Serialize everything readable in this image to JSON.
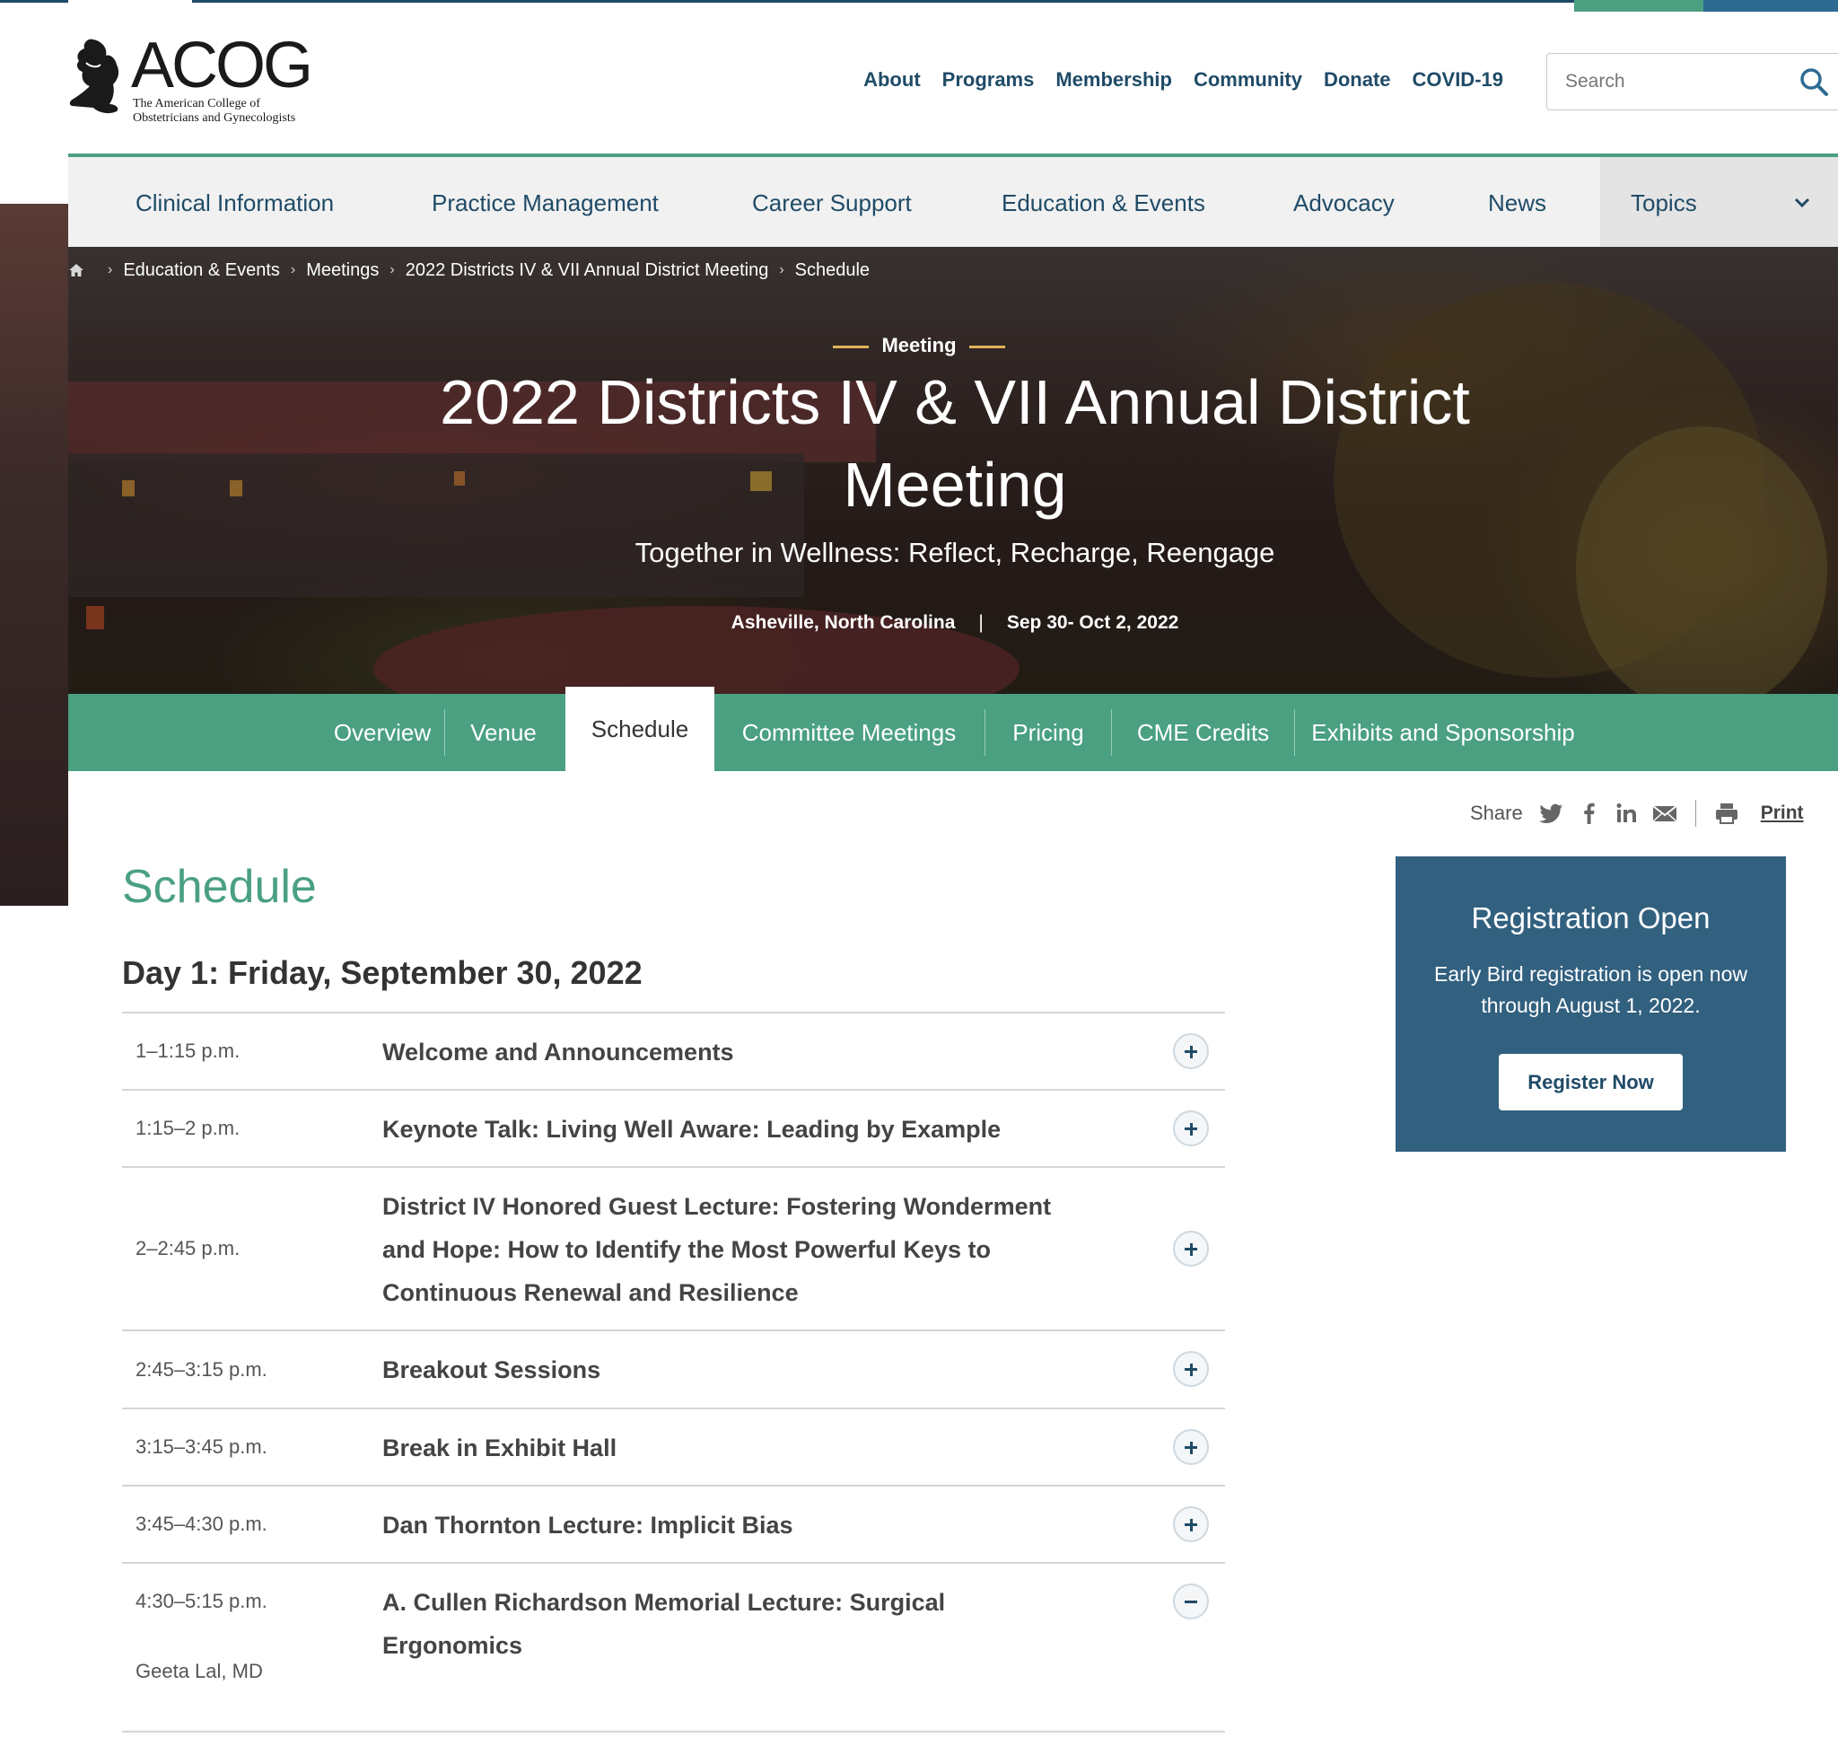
{
  "logo": {
    "wordmark": "ACOG",
    "subtitle_line1": "The American College of",
    "subtitle_line2": "Obstetricians and Gynecologists"
  },
  "utility_nav": [
    "About",
    "Programs",
    "Membership",
    "Community",
    "Donate",
    "COVID-19"
  ],
  "search": {
    "placeholder": "Search"
  },
  "main_nav": {
    "items": [
      "Clinical Information",
      "Practice Management",
      "Career Support",
      "Education & Events",
      "Advocacy",
      "News"
    ],
    "topics_label": "Topics"
  },
  "breadcrumb": [
    "Education & Events",
    "Meetings",
    "2022 Districts IV & VII Annual District Meeting",
    "Schedule"
  ],
  "hero": {
    "kicker": "Meeting",
    "title": "2022 Districts IV & VII Annual District Meeting",
    "subtitle": "Together in Wellness: Reflect, Recharge, Reengage",
    "location": "Asheville, North Carolina",
    "separator": "|",
    "dates": "Sep 30- Oct 2, 2022"
  },
  "tabs": [
    "Overview",
    "Venue",
    "Schedule",
    "Committee Meetings",
    "Pricing",
    "CME Credits",
    "Exhibits and Sponsorship"
  ],
  "active_tab": "Schedule",
  "share": {
    "label": "Share",
    "print_label": "Print"
  },
  "content": {
    "page_title": "Schedule",
    "day_title": "Day 1: Friday, September 30, 2022",
    "rows": [
      {
        "time": "1–1:15 p.m.",
        "title": "Welcome and Announcements",
        "state": "collapsed"
      },
      {
        "time": "1:15–2 p.m.",
        "title": "Keynote Talk: Living Well Aware: Leading by Example",
        "state": "collapsed"
      },
      {
        "time": "2–2:45 p.m.",
        "title": "District IV Honored Guest Lecture: Fostering Wonderment and Hope: How to Identify the Most Powerful Keys to Continuous Renewal and Resilience",
        "state": "collapsed"
      },
      {
        "time": "2:45–3:15 p.m.",
        "title": "Breakout Sessions",
        "state": "collapsed"
      },
      {
        "time": "3:15–3:45 p.m.",
        "title": "Break in Exhibit Hall",
        "state": "collapsed"
      },
      {
        "time": "3:45–4:30 p.m.",
        "title": "Dan Thornton Lecture: Implicit Bias",
        "state": "collapsed"
      },
      {
        "time": "4:30–5:15 p.m.",
        "title": "A. Cullen Richardson Memorial Lecture: Surgical Ergonomics",
        "state": "expanded",
        "speaker": "Geeta Lal, MD"
      }
    ]
  },
  "registration": {
    "title": "Registration Open",
    "text": "Early Bird registration is open now through August 1, 2022.",
    "button": "Register Now"
  },
  "colors": {
    "brand_navy": "#1f4b67",
    "brand_green": "#4aa081",
    "registration_box": "#32607f"
  }
}
